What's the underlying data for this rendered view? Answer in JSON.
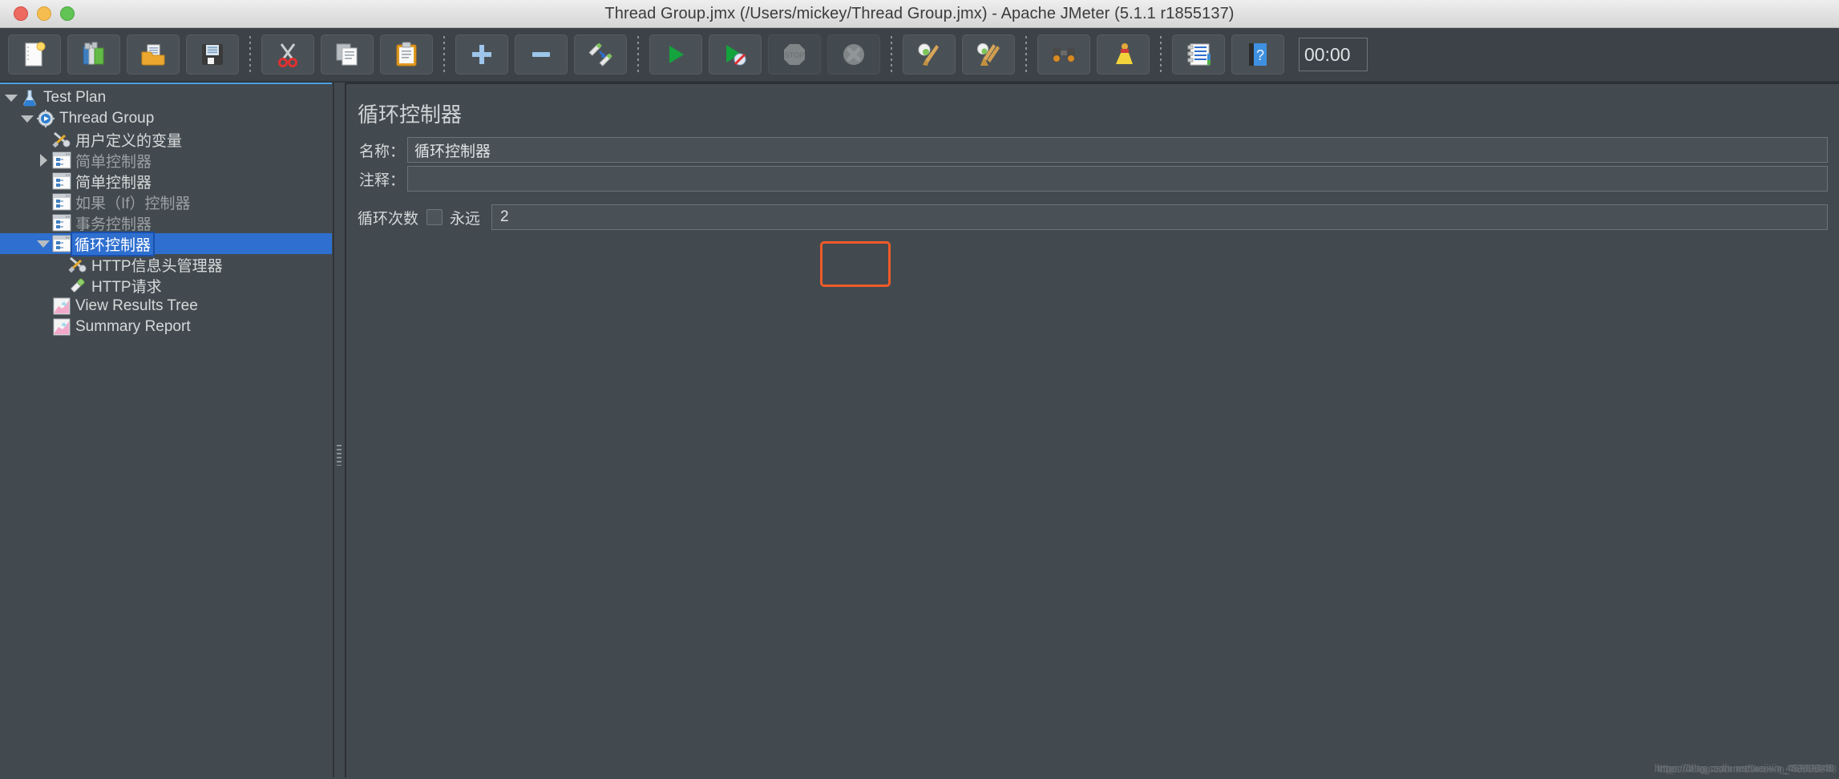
{
  "window": {
    "title": "Thread Group.jmx (/Users/mickey/Thread Group.jmx) - Apache JMeter (5.1.1 r1855137)",
    "traffic_lights": [
      "close",
      "minimize",
      "zoom"
    ]
  },
  "toolbar": {
    "timer": "00:00",
    "buttons": [
      {
        "name": "new-test-plan",
        "icon": "new-document-icon",
        "label": "New",
        "enabled": true
      },
      {
        "name": "templates",
        "icon": "templates-icon",
        "label": "Templates",
        "enabled": true
      },
      {
        "name": "open",
        "icon": "open-folder-icon",
        "label": "Open",
        "enabled": true
      },
      {
        "name": "save",
        "icon": "save-floppy-icon",
        "label": "Save Test Plan",
        "enabled": true
      },
      {
        "name": "separator-1",
        "icon": "separator",
        "label": "",
        "enabled": true
      },
      {
        "name": "cut",
        "icon": "scissors-icon",
        "label": "Cut",
        "enabled": true
      },
      {
        "name": "copy",
        "icon": "copy-pages-icon",
        "label": "Copy",
        "enabled": true
      },
      {
        "name": "paste",
        "icon": "clipboard-icon",
        "label": "Paste",
        "enabled": true
      },
      {
        "name": "separator-2",
        "icon": "separator",
        "label": "",
        "enabled": true
      },
      {
        "name": "expand-all",
        "icon": "plus-icon",
        "label": "Expand All",
        "enabled": true
      },
      {
        "name": "collapse-all",
        "icon": "minus-icon",
        "label": "Collapse All",
        "enabled": true
      },
      {
        "name": "toggle",
        "icon": "toggle-pencils-icon",
        "label": "Toggle",
        "enabled": true
      },
      {
        "name": "separator-3",
        "icon": "separator",
        "label": "",
        "enabled": true
      },
      {
        "name": "start",
        "icon": "play-green-icon",
        "label": "Start",
        "enabled": true
      },
      {
        "name": "start-no-timers",
        "icon": "play-no-timers-icon",
        "label": "Start no pauses",
        "enabled": true
      },
      {
        "name": "stop",
        "icon": "stop-sign-icon",
        "label": "Stop",
        "enabled": false
      },
      {
        "name": "shutdown",
        "icon": "shutdown-x-icon",
        "label": "Shutdown",
        "enabled": false
      },
      {
        "name": "separator-4",
        "icon": "separator",
        "label": "",
        "enabled": true
      },
      {
        "name": "clear",
        "icon": "clear-broom-icon",
        "label": "Clear",
        "enabled": true
      },
      {
        "name": "clear-all",
        "icon": "clear-all-brooms-icon",
        "label": "Clear All",
        "enabled": true
      },
      {
        "name": "separator-5",
        "icon": "separator",
        "label": "",
        "enabled": true
      },
      {
        "name": "search",
        "icon": "binoculars-icon",
        "label": "Search",
        "enabled": true
      },
      {
        "name": "reset-search",
        "icon": "yellow-broom-icon",
        "label": "Reset Search",
        "enabled": true
      },
      {
        "name": "separator-6",
        "icon": "separator",
        "label": "",
        "enabled": true
      },
      {
        "name": "function-helper",
        "icon": "notes-list-icon",
        "label": "Function Helper Dialog",
        "enabled": true
      },
      {
        "name": "help",
        "icon": "help-book-icon",
        "label": "Help",
        "enabled": true
      }
    ]
  },
  "tree": {
    "items": [
      {
        "label": "Test Plan",
        "icon": "flask-icon",
        "indent": 0,
        "twist": "down",
        "dim": false,
        "selected": false
      },
      {
        "label": "Thread Group",
        "icon": "gear-play-icon",
        "indent": 1,
        "twist": "down",
        "dim": false,
        "selected": false
      },
      {
        "label": "用户定义的变量",
        "icon": "tools-icon",
        "indent": 2,
        "twist": "none",
        "dim": false,
        "selected": false
      },
      {
        "label": "简单控制器",
        "icon": "controller-icon",
        "indent": 2,
        "twist": "right",
        "dim": true,
        "selected": false
      },
      {
        "label": "简单控制器",
        "icon": "controller-icon",
        "indent": 2,
        "twist": "none",
        "dim": false,
        "selected": false
      },
      {
        "label": "如果（If）控制器",
        "icon": "controller-icon",
        "indent": 2,
        "twist": "none",
        "dim": true,
        "selected": false
      },
      {
        "label": "事务控制器",
        "icon": "controller-icon",
        "indent": 2,
        "twist": "none",
        "dim": true,
        "selected": false
      },
      {
        "label": "循环控制器",
        "icon": "controller-icon",
        "indent": 2,
        "twist": "down",
        "dim": false,
        "selected": true
      },
      {
        "label": "HTTP信息头管理器",
        "icon": "tools-icon",
        "indent": 3,
        "twist": "none",
        "dim": false,
        "selected": false
      },
      {
        "label": "HTTP请求",
        "icon": "pipette-icon",
        "indent": 3,
        "twist": "none",
        "dim": false,
        "selected": false
      },
      {
        "label": "View Results Tree",
        "icon": "chart-icon",
        "indent": 2,
        "twist": "none",
        "dim": false,
        "selected": false
      },
      {
        "label": "Summary Report",
        "icon": "chart-icon",
        "indent": 2,
        "twist": "none",
        "dim": false,
        "selected": false
      }
    ]
  },
  "panel": {
    "title": "循环控制器",
    "name_label": "名称：",
    "name_value": "循环控制器",
    "comment_label": "注释：",
    "comment_value": "",
    "loop_label": "循环次数",
    "forever_label": "永远",
    "forever_checked": false,
    "loop_count_value": "2",
    "annotation_color": "#ef5a28"
  },
  "watermark": {
    "line1": "https://blog.csdn.net/weixin_46989848",
    "line2": "https://blog.csdn.net/weixin_46989848",
    "line3": "https://blog.csdn.net/weixin_46989848"
  }
}
